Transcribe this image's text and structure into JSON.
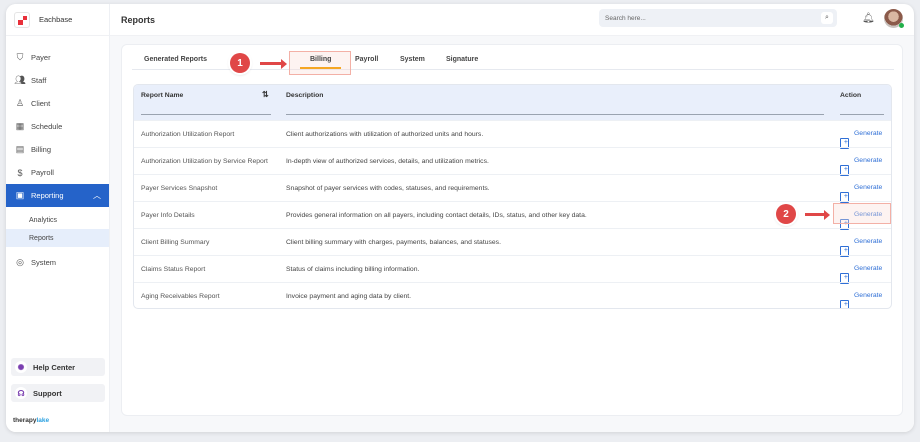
{
  "brand": {
    "name": "Eachbase"
  },
  "header": {
    "title": "Reports",
    "search_placeholder": "Search here..."
  },
  "sidebar": {
    "items": [
      {
        "label": "Payer",
        "icon": "shield-icon"
      },
      {
        "label": "Staff",
        "icon": "users-icon"
      },
      {
        "label": "Client",
        "icon": "user-icon"
      },
      {
        "label": "Schedule",
        "icon": "calendar-icon"
      },
      {
        "label": "Billing",
        "icon": "receipt-icon"
      },
      {
        "label": "Payroll",
        "icon": "money-icon"
      },
      {
        "label": "Reporting",
        "icon": "report-icon"
      }
    ],
    "sub_items": [
      {
        "label": "Analytics"
      },
      {
        "label": "Reports"
      }
    ],
    "system": "System",
    "help": "Help Center",
    "support": "Support",
    "footer_logo": "therapylake"
  },
  "tabs": [
    {
      "label": "Generated Reports"
    },
    {
      "label": "Billing"
    },
    {
      "label": "Payroll"
    },
    {
      "label": "System"
    },
    {
      "label": "Signature"
    }
  ],
  "annotations": {
    "step1": "1",
    "step2": "2"
  },
  "table": {
    "columns": [
      "Report Name",
      "Description",
      "Action"
    ],
    "sort_icon": "⇅",
    "rows": [
      {
        "name": "Authorization Utilization Report",
        "desc": "Client authorizations with utilization of authorized units and hours.",
        "action": "Generate"
      },
      {
        "name": "Authorization Utilization by Service Report",
        "desc": "In-depth view of authorized services, details, and utilization metrics.",
        "action": "Generate"
      },
      {
        "name": "Payer Services Snapshot",
        "desc": "Snapshot of payer services with codes, statuses, and requirements.",
        "action": "Generate"
      },
      {
        "name": "Payer Info Details",
        "desc": "Provides general information on all payers, including contact details, IDs, status, and other key data.",
        "action": "Generate"
      },
      {
        "name": "Client Billing Summary",
        "desc": "Client billing summary with charges, payments, balances, and statuses.",
        "action": "Generate"
      },
      {
        "name": "Claims Status Report",
        "desc": "Status of claims including billing information.",
        "action": "Generate"
      },
      {
        "name": "Aging Receivables Report",
        "desc": "Invoice payment and aging data by client.",
        "action": "Generate"
      }
    ]
  },
  "colors": {
    "accent": "#2563c9",
    "tab_underline": "#f5a623",
    "annotation": "#e04747"
  }
}
